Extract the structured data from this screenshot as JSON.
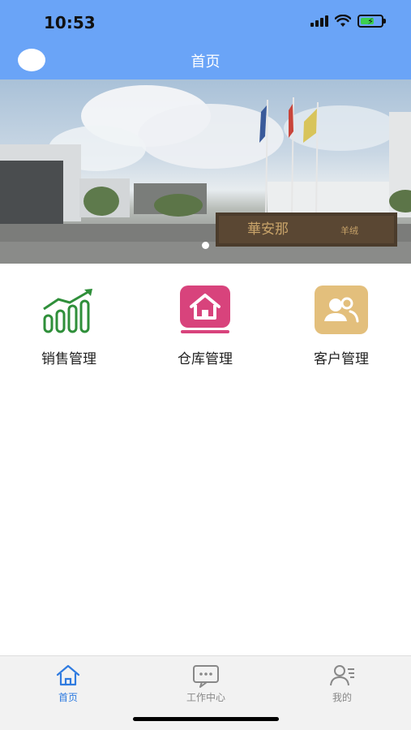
{
  "status_bar": {
    "time": "10:53"
  },
  "nav": {
    "title": "首页"
  },
  "banner": {
    "sign_text": "華安那",
    "sign_text_2": "羊绒"
  },
  "actions": [
    {
      "label": "销售管理",
      "icon": "sales-chart-icon",
      "color": "#2f8f3a"
    },
    {
      "label": "仓库管理",
      "icon": "warehouse-house-icon",
      "color": "#d8437c"
    },
    {
      "label": "客户管理",
      "icon": "customer-people-icon",
      "color": "#e3bf7c"
    }
  ],
  "tabs": [
    {
      "label": "首页",
      "icon": "home-icon",
      "active": true,
      "color": "#2f7be0"
    },
    {
      "label": "工作中心",
      "icon": "chat-icon",
      "active": false,
      "color": "#888888"
    },
    {
      "label": "我的",
      "icon": "user-icon",
      "active": false,
      "color": "#888888"
    }
  ],
  "colors": {
    "header": "#6aa4f7",
    "tab_active": "#2f7be0",
    "tab_inactive": "#888888"
  }
}
